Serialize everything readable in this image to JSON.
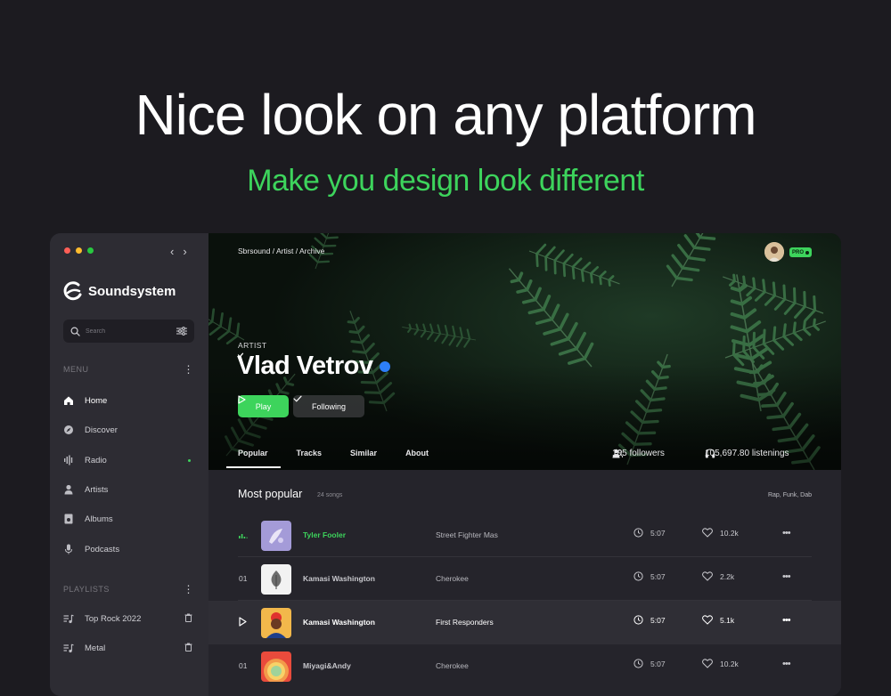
{
  "hero": {
    "title": "Nice look on any platform",
    "subtitle": "Make you design look different"
  },
  "sidebar": {
    "brand": "Soundsystem",
    "search_placeholder": "Search",
    "menu_header": "MENU",
    "items": [
      {
        "label": "Home",
        "icon": "home-icon",
        "active": true
      },
      {
        "label": "Discover",
        "icon": "compass-icon"
      },
      {
        "label": "Radio",
        "icon": "radio-wave-icon",
        "indicator": true
      },
      {
        "label": "Artists",
        "icon": "user-icon"
      },
      {
        "label": "Albums",
        "icon": "album-icon"
      },
      {
        "label": "Podcasts",
        "icon": "mic-icon"
      }
    ],
    "playlists_header": "PLAYLISTS",
    "playlists": [
      {
        "label": "Top Rock 2022"
      },
      {
        "label": "Metal"
      }
    ]
  },
  "header": {
    "breadcrumb": "Sbrsound / Artist / Archive",
    "badge": "PRO"
  },
  "artist": {
    "label": "ARTIST",
    "name": "Vlad Vetrov",
    "play_label": "Play",
    "follow_label": "Following",
    "tabs": [
      "Popular",
      "Tracks",
      "Similar",
      "About"
    ],
    "followers": "105 followers",
    "listenings": "105,697.80 listenings"
  },
  "popular": {
    "title": "Most popular",
    "count": "24 songs",
    "genres": "Rap, Funk, Dab",
    "tracks": [
      {
        "num": "",
        "artist": "Tyler Fooler",
        "song": "Street Fighter Mas",
        "duration": "5:07",
        "likes": "10.2k",
        "state": "playing"
      },
      {
        "num": "01",
        "artist": "Kamasi Washington",
        "song": "Cherokee",
        "duration": "5:07",
        "likes": "2.2k",
        "state": "normal"
      },
      {
        "num": "",
        "artist": "Kamasi Washington",
        "song": "First Responders",
        "duration": "5:07",
        "likes": "5.1k",
        "state": "hover"
      },
      {
        "num": "01",
        "artist": "Miyagi&Andy",
        "song": "Cherokee",
        "duration": "5:07",
        "likes": "10.2k",
        "state": "normal"
      }
    ]
  },
  "colors": {
    "accent": "#3dd45c",
    "background": "#1c1b20",
    "sidebar": "#2d2c33",
    "verified": "#2d7ff9"
  }
}
